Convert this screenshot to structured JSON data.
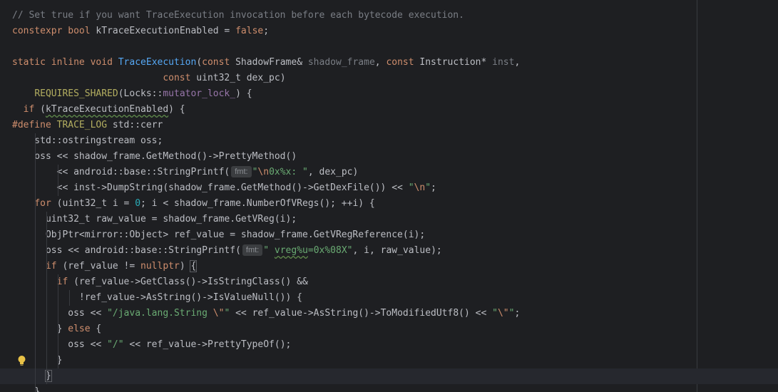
{
  "editor": {
    "lines": [
      [
        {
          "c": "c-comment",
          "t": "// Set true if you want TraceExecution invocation before each bytecode execution."
        }
      ],
      [
        {
          "c": "c-kw",
          "t": "constexpr"
        },
        {
          "t": " "
        },
        {
          "c": "c-kw",
          "t": "bool"
        },
        {
          "t": " kTraceExecutionEnabled = "
        },
        {
          "c": "c-kw",
          "t": "false"
        },
        {
          "t": ";"
        }
      ],
      [
        {
          "t": ""
        }
      ],
      [
        {
          "c": "c-kw",
          "t": "static"
        },
        {
          "t": " "
        },
        {
          "c": "c-kw",
          "t": "inline"
        },
        {
          "t": " "
        },
        {
          "c": "c-kw",
          "t": "void"
        },
        {
          "t": " "
        },
        {
          "c": "c-fn",
          "t": "TraceExecution"
        },
        {
          "t": "("
        },
        {
          "c": "c-kw",
          "t": "const"
        },
        {
          "t": " ShadowFrame& "
        },
        {
          "c": "c-param",
          "t": "shadow_frame"
        },
        {
          "t": ", "
        },
        {
          "c": "c-kw",
          "t": "const"
        },
        {
          "t": " Instruction* "
        },
        {
          "c": "c-param",
          "t": "inst"
        },
        {
          "t": ","
        }
      ],
      [
        {
          "t": "                           "
        },
        {
          "c": "c-kw",
          "t": "const"
        },
        {
          "t": " uint32_t dex_pc)"
        }
      ],
      [
        {
          "t": "    "
        },
        {
          "c": "c-macro",
          "t": "REQUIRES_SHARED"
        },
        {
          "t": "(Locks::"
        },
        {
          "c": "c-field",
          "t": "mutator_lock_"
        },
        {
          "t": ") {"
        }
      ],
      [
        {
          "t": "  "
        },
        {
          "c": "c-kw",
          "t": "if"
        },
        {
          "t": " ("
        },
        {
          "sq": true,
          "t": "kTraceExecutionEnabled"
        },
        {
          "t": ") {"
        }
      ],
      [
        {
          "c": "c-kw",
          "t": "#define"
        },
        {
          "t": " "
        },
        {
          "c": "c-def",
          "t": "TRACE_LOG"
        },
        {
          "t": " std::cerr"
        }
      ],
      [
        {
          "t": "    std::ostringstream oss;"
        }
      ],
      [
        {
          "t": "    oss << shadow_frame.GetMethod()->PrettyMethod()"
        }
      ],
      [
        {
          "t": "        << android::base::StringPrintf("
        },
        {
          "hint": "fmt:"
        },
        {
          "c": "c-str",
          "t": "\""
        },
        {
          "c": "c-esc",
          "t": "\\n"
        },
        {
          "c": "c-str",
          "t": "0x%x: \""
        },
        {
          "t": ", dex_pc)"
        }
      ],
      [
        {
          "t": "        << inst->DumpString(shadow_frame.GetMethod()->GetDexFile()) << "
        },
        {
          "c": "c-str",
          "t": "\""
        },
        {
          "c": "c-esc",
          "t": "\\n"
        },
        {
          "c": "c-str",
          "t": "\""
        },
        {
          "t": ";"
        }
      ],
      [
        {
          "t": "    "
        },
        {
          "c": "c-kw",
          "t": "for"
        },
        {
          "t": " (uint32_t i = "
        },
        {
          "c": "c-num",
          "t": "0"
        },
        {
          "t": "; i < shadow_frame.NumberOfVRegs(); ++i) {"
        }
      ],
      [
        {
          "t": "      uint32_t raw_value = shadow_frame.GetVReg(i);"
        }
      ],
      [
        {
          "t": "      ObjPtr<mirror::Object> ref_value = shadow_frame.GetVRegReference(i);"
        }
      ],
      [
        {
          "t": "      oss << android::base::StringPrintf("
        },
        {
          "hint": "fmt:"
        },
        {
          "c": "c-str",
          "t": "\" "
        },
        {
          "c": "c-str",
          "sq": true,
          "t": "vreg%u"
        },
        {
          "c": "c-str",
          "t": "=0x%08X\""
        },
        {
          "t": ", i, raw_value);"
        }
      ],
      [
        {
          "t": "      "
        },
        {
          "c": "c-kw",
          "t": "if"
        },
        {
          "t": " (ref_value != "
        },
        {
          "c": "c-kw",
          "t": "nullptr"
        },
        {
          "t": ") "
        },
        {
          "c": "c-brace-hl",
          "t": "{"
        }
      ],
      [
        {
          "t": "        "
        },
        {
          "c": "c-kw",
          "t": "if"
        },
        {
          "t": " (ref_value->GetClass()->IsStringClass() &&"
        }
      ],
      [
        {
          "t": "            !ref_value->AsString()->IsValueNull()) {"
        }
      ],
      [
        {
          "t": "          oss << "
        },
        {
          "c": "c-str",
          "t": "\"/java.lang.String "
        },
        {
          "c": "c-esc",
          "t": "\\\""
        },
        {
          "c": "c-str",
          "t": "\""
        },
        {
          "t": " << ref_value->AsString()->ToModifiedUtf8() << "
        },
        {
          "c": "c-str",
          "t": "\""
        },
        {
          "c": "c-esc",
          "t": "\\\""
        },
        {
          "c": "c-str",
          "t": "\""
        },
        {
          "t": ";"
        }
      ],
      [
        {
          "t": "        } "
        },
        {
          "c": "c-kw",
          "t": "else"
        },
        {
          "t": " {"
        }
      ],
      [
        {
          "t": "          oss << "
        },
        {
          "c": "c-str",
          "t": "\"/\""
        },
        {
          "t": " << ref_value->PrettyTypeOf();"
        }
      ],
      [
        {
          "t": "        }"
        }
      ],
      [
        {
          "t": "      "
        },
        {
          "c": "c-brace-hl",
          "t": "}"
        }
      ],
      [
        {
          "t": "    }"
        }
      ]
    ]
  },
  "colors": {
    "background": "#1e1f22",
    "current_line": "#26282e",
    "bulb": "#e8c146"
  },
  "icons": {
    "intention_bulb": "lightbulb-icon"
  }
}
